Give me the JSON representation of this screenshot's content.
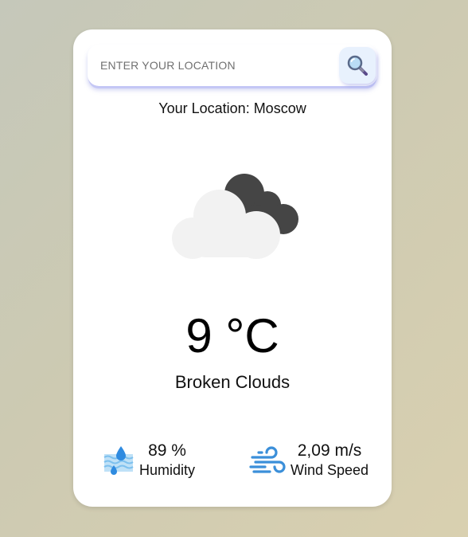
{
  "search": {
    "placeholder": "ENTER YOUR LOCATION",
    "button_icon": "search-icon"
  },
  "location": {
    "text": "Your Location: Moscow"
  },
  "weather": {
    "icon": "broken-clouds-icon",
    "temperature": "9 °C",
    "description": "Broken Clouds"
  },
  "stats": {
    "humidity": {
      "icon": "humidity-icon",
      "value": "89 %",
      "label": "Humidity"
    },
    "wind": {
      "icon": "wind-icon",
      "value": "2,09 m/s",
      "label": "Wind Speed"
    }
  },
  "colors": {
    "accent": "#3b8fd9",
    "search_shadow": "#c4c7f5",
    "search_button_bg": "#e8f1fd"
  }
}
